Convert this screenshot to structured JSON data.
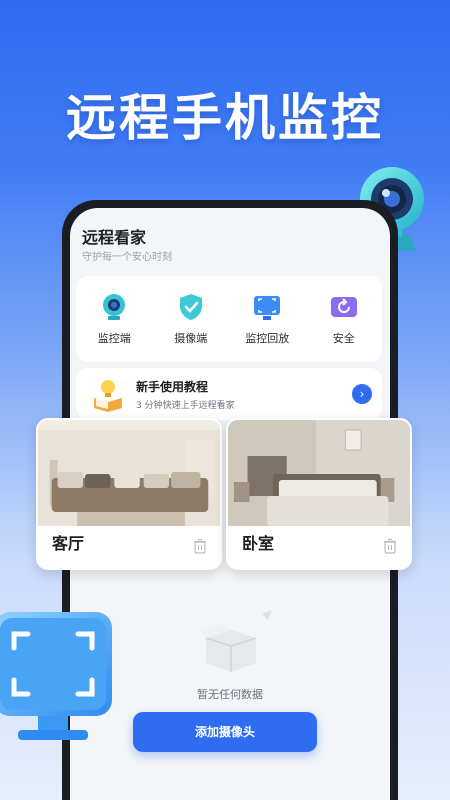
{
  "hero": {
    "title": "远程手机监控"
  },
  "app": {
    "title": "远程看家",
    "subtitle": "守护每一个安心时刻"
  },
  "quick_actions": [
    {
      "label": "监控端",
      "icon": "camera-icon"
    },
    {
      "label": "摄像端",
      "icon": "shield-check-icon"
    },
    {
      "label": "监控回放",
      "icon": "playback-screen-icon"
    },
    {
      "label": "安全",
      "icon": "safety-refresh-icon"
    }
  ],
  "tutorial": {
    "title": "新手使用教程",
    "subtitle": "3 分钟快速上手远程看家",
    "icon": "book-bulb-icon"
  },
  "rooms": [
    {
      "name": "客厅",
      "icon": "trash-icon"
    },
    {
      "name": "卧室",
      "icon": "trash-icon"
    }
  ],
  "empty_state": {
    "text": "暂无任何数据"
  },
  "add_camera_button": {
    "label": "添加摄像头"
  },
  "colors": {
    "accent": "#2e6cf0",
    "hero_bg": "#2f6cf2",
    "teal": "#3ec9d6"
  }
}
